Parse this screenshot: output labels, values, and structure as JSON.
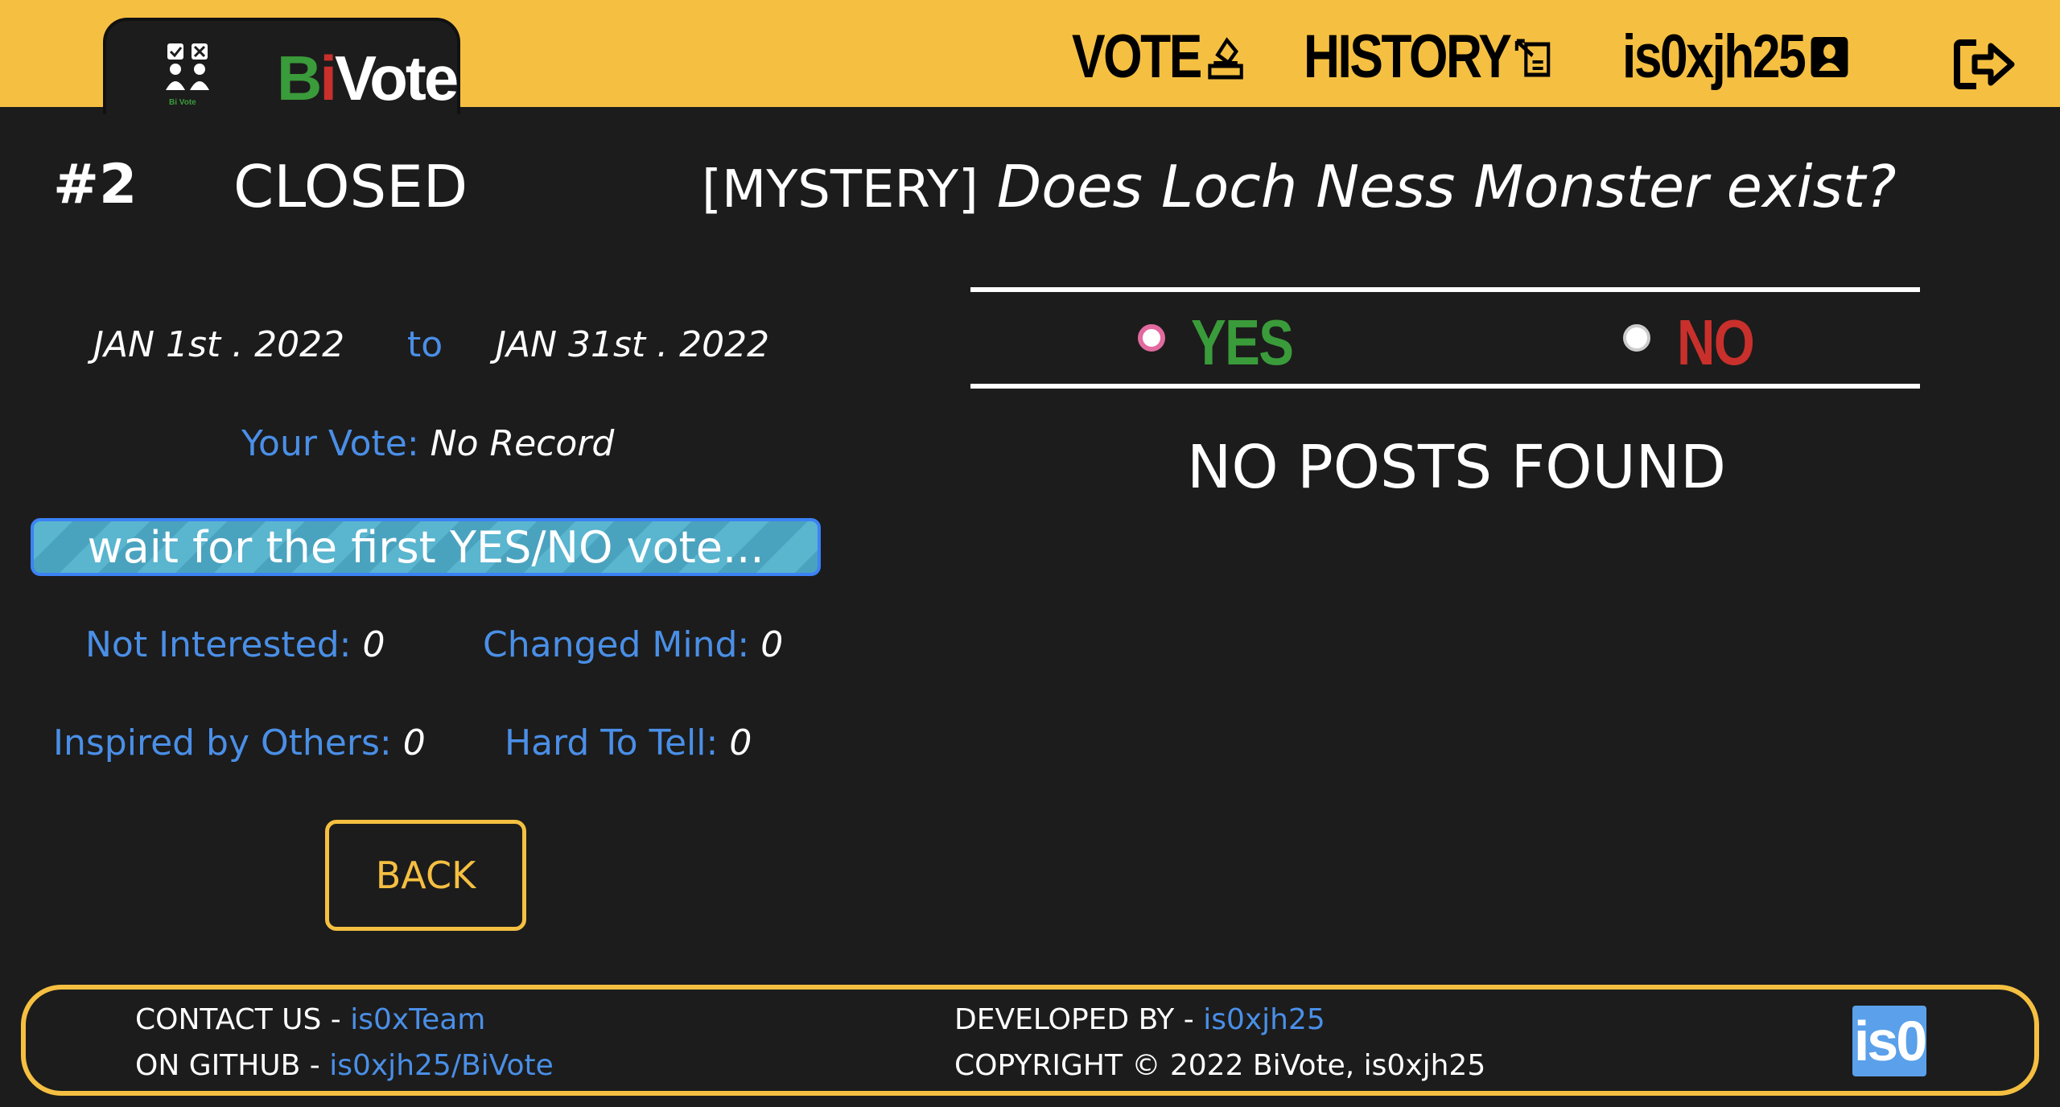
{
  "header": {
    "logo": {
      "b": "B",
      "i": "i",
      "vote": "Vote",
      "icon_caption": "Bi Vote"
    },
    "nav": {
      "vote": "VOTE",
      "history": "HISTORY",
      "user": "is0xjh25"
    },
    "icons": {
      "vote": "ballot-box-icon",
      "history": "history-icon",
      "user": "user-icon",
      "logout": "logout-icon"
    },
    "colors": {
      "bar": "#f5bf41",
      "brand_green": "#3a9b3a",
      "brand_red": "#c9302c"
    }
  },
  "poll": {
    "number": "#2",
    "status": "CLOSED",
    "category": "[MYSTERY]",
    "question": "Does Loch Ness Monster exist?",
    "start_date": "JAN 1st . 2022",
    "to": "to",
    "end_date": "JAN 31st . 2022",
    "your_vote_label": "Your Vote:",
    "your_vote_value": "No Record",
    "progress_text": "wait for the first YES/NO vote...",
    "stats": {
      "not_interested_label": "Not Interested:",
      "not_interested": "0",
      "changed_mind_label": "Changed Mind:",
      "changed_mind": "0",
      "inspired_label": "Inspired by Others:",
      "inspired": "0",
      "hard_to_tell_label": "Hard To Tell:",
      "hard_to_tell": "0"
    },
    "back_label": "BACK"
  },
  "posts": {
    "yes_label": "YES",
    "no_label": "NO",
    "selected": "YES",
    "empty_text": "NO POSTS FOUND"
  },
  "footer": {
    "contact_label": "CONTACT US -",
    "contact_link": "is0xTeam",
    "github_label": "ON GITHUB -",
    "github_link": "is0xjh25/BiVote",
    "developed_label": "DEVELOPED BY -",
    "developed_link": "is0xjh25",
    "copyright": "COPYRIGHT © 2022 BiVote, is0xjh25",
    "badge": "is0"
  }
}
